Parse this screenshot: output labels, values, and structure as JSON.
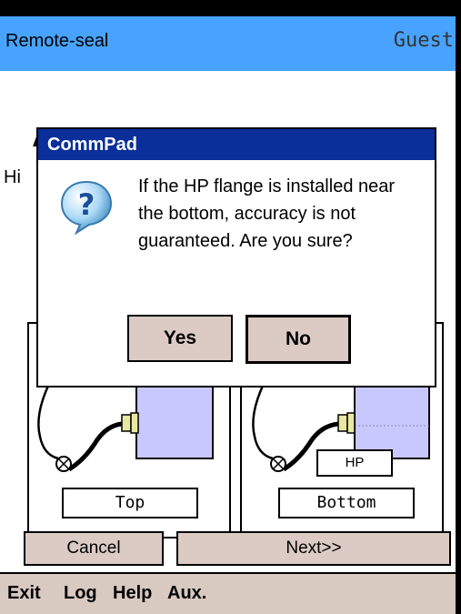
{
  "header": {
    "app_title": "Remote-seal",
    "user": "Guest"
  },
  "main": {
    "partial_heading": "A",
    "partial_text": "Hi",
    "options": [
      {
        "position_label": "Top"
      },
      {
        "position_label": "Bottom",
        "flange_label": "HP"
      }
    ]
  },
  "footer_buttons": {
    "cancel": "Cancel",
    "next": "Next>>"
  },
  "menu": {
    "items": [
      "Exit",
      "Log",
      "Help",
      "Aux."
    ]
  },
  "dialog": {
    "title": "CommPad",
    "icon": "question-icon",
    "message": "If the HP flange is installed near the bottom, accuracy is not guaranteed. Are you sure?",
    "yes": "Yes",
    "no": "No"
  },
  "colors": {
    "header_bg": "#47a3ff",
    "dialog_title_bg": "#0a2f9a",
    "button_bg": "#dbcbc4",
    "flange_fill": "#c8c8ff"
  }
}
